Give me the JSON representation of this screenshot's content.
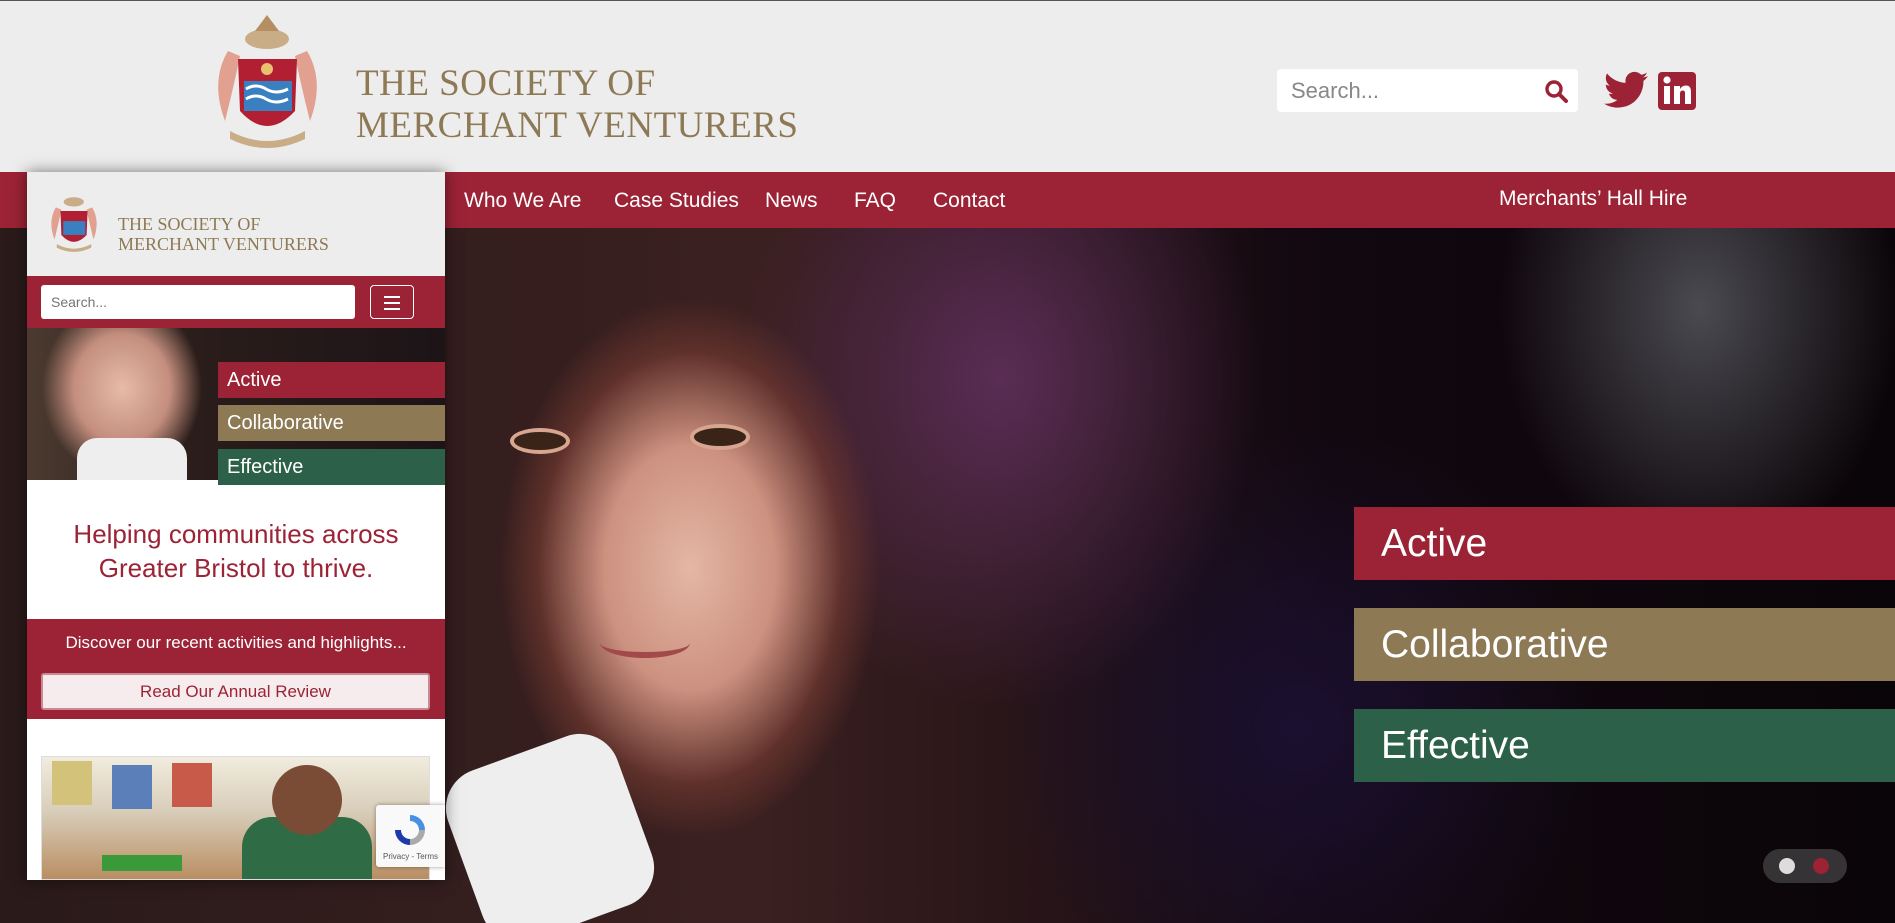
{
  "header": {
    "brand_line1": "THE SOCIETY OF",
    "brand_line2": "MERCHANT VENTURERS",
    "search_placeholder": "Search...",
    "social": [
      "twitter-icon",
      "linkedin-icon"
    ]
  },
  "nav": {
    "items": [
      "Who We Are",
      "Case Studies",
      "News",
      "FAQ",
      "Contact"
    ],
    "right_item": "Merchants’ Hall Hire"
  },
  "hero": {
    "tags": [
      "Active",
      "Collaborative",
      "Effective"
    ],
    "slides": 2,
    "active_slide": 2
  },
  "mobile": {
    "brand_line1": "THE SOCIETY OF",
    "brand_line2": "MERCHANT VENTURERS",
    "search_placeholder": "Search...",
    "tags": [
      "Active",
      "Collaborative",
      "Effective"
    ],
    "tagline_line1": "Helping communities across",
    "tagline_line2": "Greater Bristol to thrive.",
    "cta_text": "Discover our recent activities and highlights...",
    "cta_button": "Read Our Annual Review",
    "recaptcha_text": "Privacy - Terms"
  },
  "colors": {
    "crimson": "#9b2335",
    "gold": "#8d7a55",
    "green": "#2c6048",
    "header_bg": "#eeeded"
  }
}
